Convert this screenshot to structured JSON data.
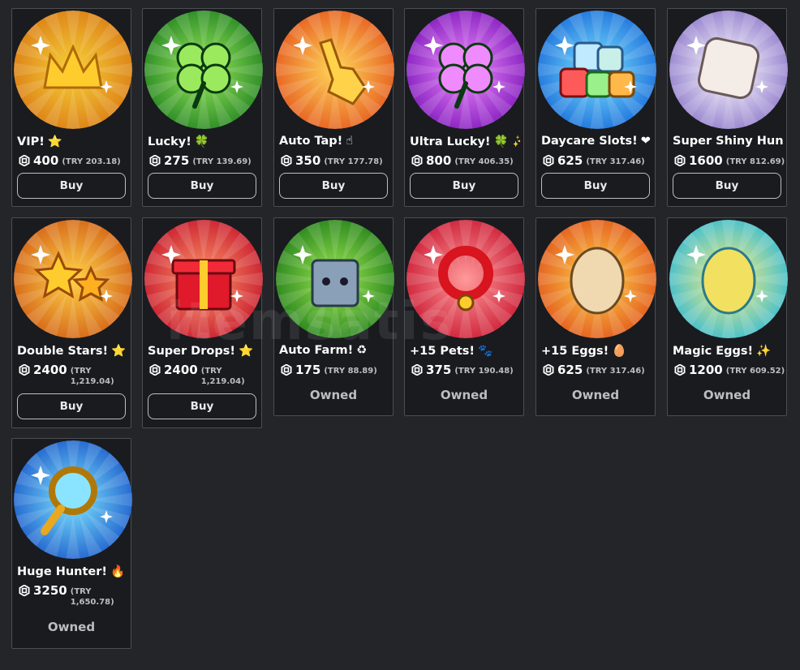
{
  "watermark": "itemsatis",
  "items": [
    {
      "title": "VIP!",
      "emoji": "⭐",
      "amount": "400",
      "local": "(TRY 203.18)",
      "action": "Buy",
      "owned": false,
      "colors": [
        "#f7d13a",
        "#d97812"
      ]
    },
    {
      "title": "Lucky!",
      "emoji": "🍀",
      "amount": "275",
      "local": "(TRY 139.69)",
      "action": "Buy",
      "owned": false,
      "colors": [
        "#9bea5e",
        "#1d7f1e"
      ]
    },
    {
      "title": "Auto Tap!",
      "emoji": "☝",
      "amount": "350",
      "local": "(TRY 177.78)",
      "action": "Buy",
      "owned": false,
      "colors": [
        "#ffd65a",
        "#e4531a"
      ]
    },
    {
      "title": "Ultra Lucky!",
      "emoji": "🍀 ✨",
      "amount": "800",
      "local": "(TRY 406.35)",
      "action": "Buy",
      "owned": false,
      "colors": [
        "#f08bff",
        "#7a14b8"
      ]
    },
    {
      "title": "Daycare Slots!",
      "emoji": "❤",
      "amount": "625",
      "local": "(TRY 317.46)",
      "action": "Buy",
      "owned": false,
      "colors": [
        "#7fe3ff",
        "#1468d8"
      ]
    },
    {
      "title": "Super Shiny Hun...",
      "emoji": "",
      "amount": "1600",
      "local": "(TRY 812.69)",
      "action": "Buy",
      "owned": false,
      "colors": [
        "#ffffff",
        "#8a74c9"
      ]
    },
    {
      "title": "Double Stars!",
      "emoji": "⭐",
      "amount": "2400",
      "local": "(TRY 1,219.04)",
      "action": "Buy",
      "owned": false,
      "colors": [
        "#ffd44a",
        "#d05a12"
      ]
    },
    {
      "title": "Super Drops!",
      "emoji": "⭐",
      "amount": "2400",
      "local": "(TRY 1,219.04)",
      "action": "Buy",
      "owned": false,
      "colors": [
        "#ff9a6a",
        "#c4122a"
      ]
    },
    {
      "title": "Auto Farm!",
      "emoji": "♻",
      "amount": "175",
      "local": "(TRY 88.89)",
      "action": "Owned",
      "owned": true,
      "colors": [
        "#9ce850",
        "#1d7a18"
      ]
    },
    {
      "title": "+15 Pets!",
      "emoji": "🐾",
      "amount": "375",
      "local": "(TRY 190.48)",
      "action": "Owned",
      "owned": true,
      "colors": [
        "#ff9a9a",
        "#c8142e"
      ]
    },
    {
      "title": "+15 Eggs!",
      "emoji": "🥚",
      "amount": "625",
      "local": "(TRY 317.46)",
      "action": "Owned",
      "owned": true,
      "colors": [
        "#ffd44a",
        "#e0501a"
      ]
    },
    {
      "title": "Magic Eggs!",
      "emoji": "✨",
      "amount": "1200",
      "local": "(TRY 609.52)",
      "action": "Owned",
      "owned": true,
      "colors": [
        "#fff07a",
        "#2db8d8"
      ]
    },
    {
      "title": "Huge Hunter!",
      "emoji": "🔥",
      "amount": "3250",
      "local": "(TRY 1,650.78)",
      "action": "Owned",
      "owned": true,
      "colors": [
        "#7fe6ff",
        "#1654c8"
      ]
    }
  ]
}
